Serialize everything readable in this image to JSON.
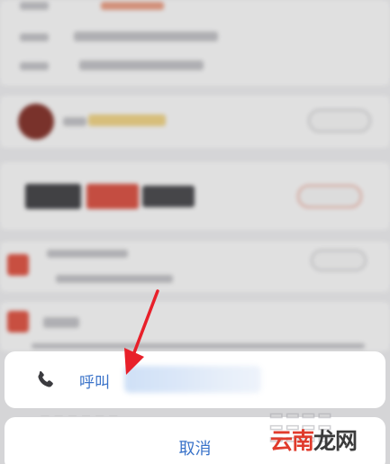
{
  "action_sheet": {
    "call_label": "呼叫",
    "cancel_label": "取消"
  },
  "watermark": {
    "text_part1": "云南",
    "text_part2": "龙网"
  },
  "colors": {
    "action_blue": "#3a73c9",
    "annotation_red": "#e8202a",
    "watermark_red": "#e03b2c"
  }
}
